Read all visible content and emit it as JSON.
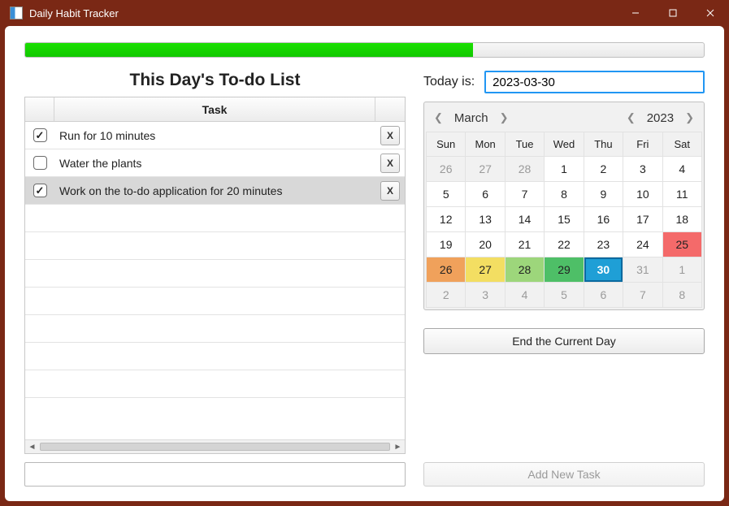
{
  "window": {
    "title": "Daily Habit Tracker"
  },
  "progress": {
    "percent": 66
  },
  "list": {
    "heading": "This Day's To-do List",
    "column_header": "Task",
    "delete_label": "X",
    "tasks": [
      {
        "text": "Run for 10 minutes",
        "done": true,
        "selected": false
      },
      {
        "text": "Water the plants",
        "done": false,
        "selected": false
      },
      {
        "text": "Work on the to-do application for 20 minutes",
        "done": true,
        "selected": true
      }
    ]
  },
  "date": {
    "label": "Today is:",
    "value": "2023-03-30"
  },
  "calendar": {
    "month_label": "March",
    "year_label": "2023",
    "weekdays": [
      "Sun",
      "Mon",
      "Tue",
      "Wed",
      "Thu",
      "Fri",
      "Sat"
    ],
    "colors": {
      "25": "#f46a6a",
      "26": "#f0a15b",
      "27": "#f3de62",
      "28": "#9dd67b",
      "29": "#4ebf67"
    },
    "cells": [
      {
        "n": "26",
        "dim": true
      },
      {
        "n": "27",
        "dim": true
      },
      {
        "n": "28",
        "dim": true
      },
      {
        "n": "1"
      },
      {
        "n": "2"
      },
      {
        "n": "3"
      },
      {
        "n": "4"
      },
      {
        "n": "5"
      },
      {
        "n": "6"
      },
      {
        "n": "7"
      },
      {
        "n": "8"
      },
      {
        "n": "9"
      },
      {
        "n": "10"
      },
      {
        "n": "11"
      },
      {
        "n": "12"
      },
      {
        "n": "13"
      },
      {
        "n": "14"
      },
      {
        "n": "15"
      },
      {
        "n": "16"
      },
      {
        "n": "17"
      },
      {
        "n": "18"
      },
      {
        "n": "19"
      },
      {
        "n": "20"
      },
      {
        "n": "21"
      },
      {
        "n": "22"
      },
      {
        "n": "23"
      },
      {
        "n": "24"
      },
      {
        "n": "25",
        "color": "25"
      },
      {
        "n": "26",
        "color": "26"
      },
      {
        "n": "27",
        "color": "27"
      },
      {
        "n": "28",
        "color": "28"
      },
      {
        "n": "29",
        "color": "29"
      },
      {
        "n": "30",
        "today": true
      },
      {
        "n": "31",
        "dim": true
      },
      {
        "n": "1",
        "dim": true
      },
      {
        "n": "2",
        "dim": true
      },
      {
        "n": "3",
        "dim": true
      },
      {
        "n": "4",
        "dim": true
      },
      {
        "n": "5",
        "dim": true
      },
      {
        "n": "6",
        "dim": true
      },
      {
        "n": "7",
        "dim": true
      },
      {
        "n": "8",
        "dim": true
      }
    ]
  },
  "buttons": {
    "end_day": "End the Current Day",
    "add_task": "Add New Task"
  },
  "new_task": {
    "value": ""
  }
}
